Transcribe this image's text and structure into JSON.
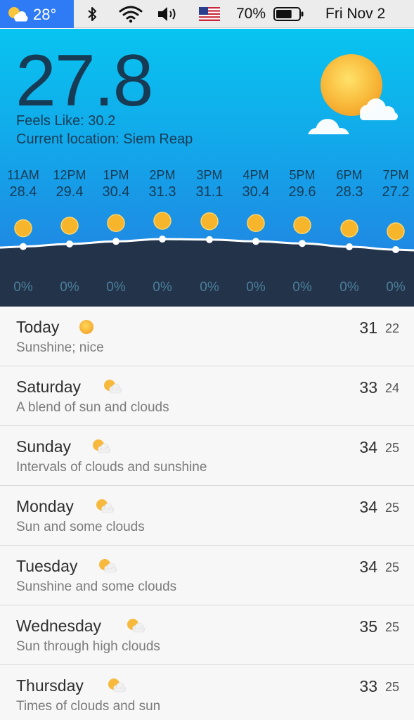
{
  "menubar": {
    "app_icon": "sun-behind-cloud-icon",
    "app_temp": "28°",
    "bluetooth_icon": "bluetooth-icon",
    "wifi_icon": "wifi-icon",
    "volume_icon": "volume-icon",
    "flag_icon": "us-flag-icon",
    "battery_percent": "70%",
    "battery_level": 0.7,
    "datetime": "Fri Nov 2"
  },
  "current": {
    "temperature": "27.8",
    "feels_like": "Feels Like: 30.2",
    "location": "Current location: Siem Reap",
    "icon": "sun-with-clouds-icon"
  },
  "hourly": [
    {
      "time": "11AM",
      "temp": "28.4",
      "precip": "0%"
    },
    {
      "time": "12PM",
      "temp": "29.4",
      "precip": "0%"
    },
    {
      "time": "1PM",
      "temp": "30.4",
      "precip": "0%"
    },
    {
      "time": "2PM",
      "temp": "31.3",
      "precip": "0%"
    },
    {
      "time": "3PM",
      "temp": "31.1",
      "precip": "0%"
    },
    {
      "time": "4PM",
      "temp": "30.4",
      "precip": "0%"
    },
    {
      "time": "5PM",
      "temp": "29.6",
      "precip": "0%"
    },
    {
      "time": "6PM",
      "temp": "28.3",
      "precip": "0%"
    },
    {
      "time": "7PM",
      "temp": "27.2",
      "precip": "0%"
    }
  ],
  "colors": {
    "menubar_accent": "#2f7bf5",
    "header_top": "#08c4f0",
    "header_bottom": "#2079de",
    "graph_fill": "#22334a",
    "text_dark": "#173b54",
    "sun": "#f7b52c"
  },
  "days": [
    {
      "name": "Today",
      "icon": "sun-icon",
      "desc": "Sunshine; nice",
      "hi": "31",
      "lo": "22"
    },
    {
      "name": "Saturday",
      "icon": "partly-cloudy-icon",
      "desc": "A blend of sun and clouds",
      "hi": "33",
      "lo": "24"
    },
    {
      "name": "Sunday",
      "icon": "partly-cloudy-icon",
      "desc": "Intervals of clouds and sunshine",
      "hi": "34",
      "lo": "25"
    },
    {
      "name": "Monday",
      "icon": "partly-cloudy-icon",
      "desc": "Sun and some clouds",
      "hi": "34",
      "lo": "25"
    },
    {
      "name": "Tuesday",
      "icon": "partly-cloudy-icon",
      "desc": "Sunshine and some clouds",
      "hi": "34",
      "lo": "25"
    },
    {
      "name": "Wednesday",
      "icon": "partly-cloudy-icon",
      "desc": "Sun through high clouds",
      "hi": "35",
      "lo": "25"
    },
    {
      "name": "Thursday",
      "icon": "partly-cloudy-icon",
      "desc": "Times of clouds and sun",
      "hi": "33",
      "lo": "25"
    }
  ]
}
